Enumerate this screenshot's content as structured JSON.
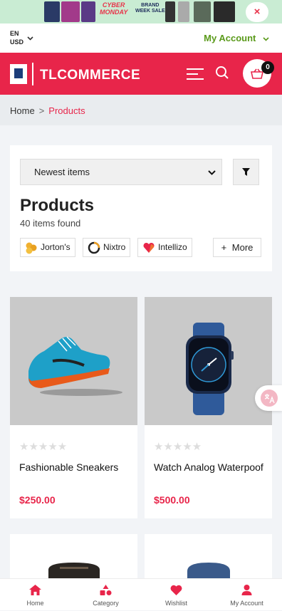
{
  "promo_banner": {
    "line1": "CYBER",
    "line2": "MONDAY",
    "brand_line1": "BRAND",
    "brand_line2": "WEEK SALE",
    "close_label": "×"
  },
  "topbar": {
    "language": "EN",
    "currency": "USD",
    "account_label": "My Account"
  },
  "header": {
    "logo_text": "TLCOMMERCE",
    "cart_count": "0"
  },
  "breadcrumb": {
    "home": "Home",
    "separator": ">",
    "current": "Products"
  },
  "filters": {
    "sort_value": "Newest items",
    "title": "Products",
    "count_text": "40 items found",
    "brands": [
      "Jorton's",
      "Nixtro",
      "Intellizo"
    ],
    "more_label": "More",
    "more_icon": "+"
  },
  "products": [
    {
      "name": "Fashionable Sneakers",
      "price": "$250.00",
      "rating": "★★★★★"
    },
    {
      "name": "Watch Analog Waterpoof",
      "price": "$500.00",
      "rating": "★★★★★"
    }
  ],
  "bottom_nav": [
    {
      "label": "Home",
      "icon": "home-icon"
    },
    {
      "label": "Category",
      "icon": "category-icon"
    },
    {
      "label": "Wishlist",
      "icon": "heart-icon"
    },
    {
      "label": "My Account",
      "icon": "user-icon"
    }
  ],
  "colors": {
    "brand": "#e8254a",
    "account_green": "#5a9a1a",
    "price": "#e8254a"
  }
}
